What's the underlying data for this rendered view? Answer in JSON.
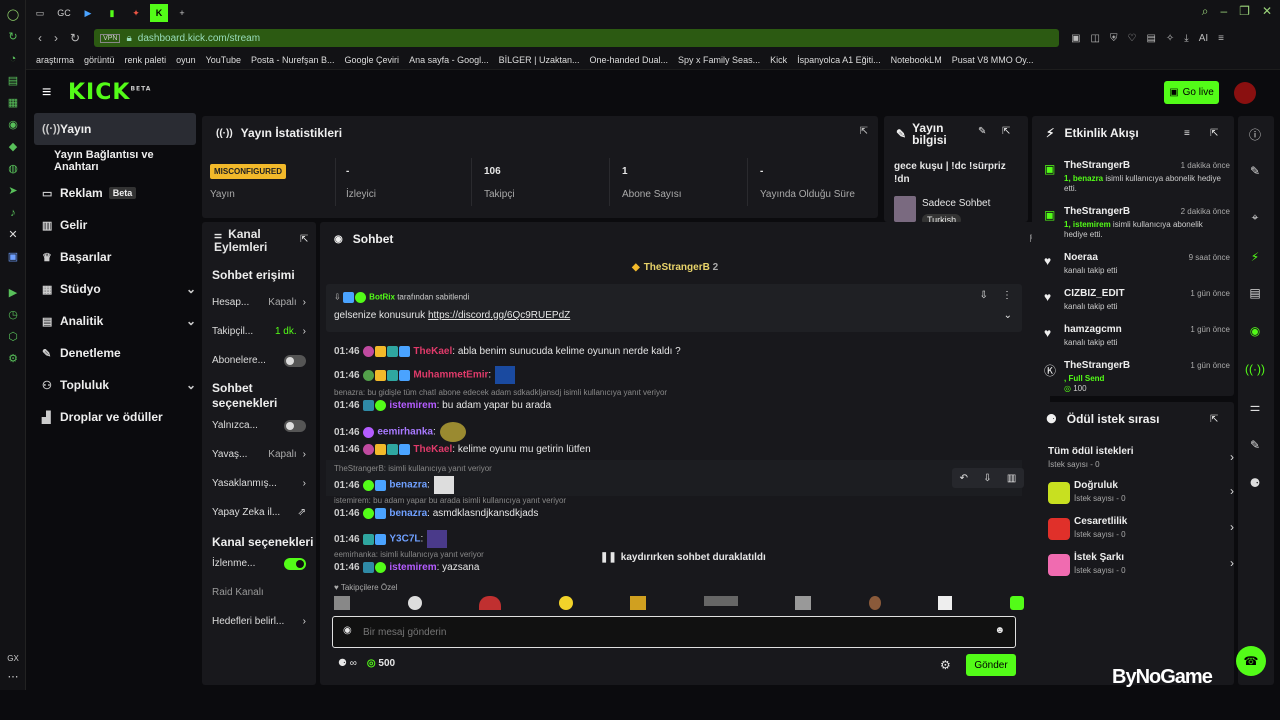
{
  "browser": {
    "url": "dashboard.kick.com/stream",
    "vpn_label": "VPN",
    "tabs": [
      "GC",
      "K"
    ],
    "bookmarks": [
      "araştırma",
      "görüntü",
      "renk paleti",
      "oyun",
      "YouTube",
      "Posta - Nurefşan B...",
      "Google Çeviri",
      "Ana sayfa - Googl...",
      "BİLGER | Uzaktan...",
      "One-handed Dual...",
      "Spy x Family Seas...",
      "Kick",
      "İspanyolca A1 Eğiti...",
      "NotebookLM",
      "Pusat V8 MMO Oy..."
    ],
    "ai_label": "AI"
  },
  "header": {
    "logo": "KICK",
    "logo_sup": "BETA",
    "go_live": "Go live"
  },
  "nav": {
    "items": [
      {
        "label": "Yayın"
      },
      {
        "label": "Yayın Bağlantısı ve Anahtarı"
      },
      {
        "label": "Reklam",
        "badge": "Beta"
      },
      {
        "label": "Gelir"
      },
      {
        "label": "Başarılar"
      },
      {
        "label": "Stüdyo"
      },
      {
        "label": "Analitik"
      },
      {
        "label": "Denetleme"
      },
      {
        "label": "Topluluk"
      },
      {
        "label": "Droplar ve ödüller"
      }
    ]
  },
  "stats": {
    "title": "Yayın İstatistikleri",
    "status_badge": "MISCONFIGURED",
    "status_label": "Yayın",
    "items": [
      {
        "value": "-",
        "label": "İzleyici"
      },
      {
        "value": "106",
        "label": "Takipçi"
      },
      {
        "value": "1",
        "label": "Abone Sayısı"
      },
      {
        "value": "-",
        "label": "Yayında Olduğu Süre"
      }
    ]
  },
  "info": {
    "title": "Yayın bilgisi",
    "stream_title": "gece kuşu | !dc !sürpriz !dn",
    "category": "Sadece Sohbet",
    "tag": "Turkish"
  },
  "actions": {
    "title": "Kanal Eylemleri",
    "sec1": "Sohbet erişimi",
    "r1": "Hesap...",
    "r1v": "Kapalı",
    "r2": "Takipçil...",
    "r2v": "1 dk.",
    "r3": "Abonelere...",
    "sec2": "Sohbet seçenekleri",
    "r4": "Yalnızca...",
    "r5": "Yavaş...",
    "r5v": "Kapalı",
    "r6": "Yasaklanmış...",
    "r7": "Yapay Zeka il...",
    "sec3": "Kanal seçenekleri",
    "r8": "İzlenme...",
    "r9": "Raid Kanalı",
    "r10": "Hedefleri belirl..."
  },
  "chat": {
    "title": "Sohbet",
    "top_user": "TheStrangerB",
    "top_count": "2",
    "pinned_by": "BotRix",
    "pinned_suffix": "tarafından sabitlendi",
    "pinned_text": "gelsenize konusuruk",
    "pinned_link": "https://discord.gg/6Qc9RUEPdZ",
    "messages": [
      {
        "time": "01:46",
        "user": "TheKael",
        "text": ": abla benim sunucuda kelime oyunun nerde kaldı ?"
      },
      {
        "time": "01:46",
        "user": "MuhammetEmir",
        "text": ":"
      },
      {
        "time": "01:46",
        "user": "istemirem",
        "text": ": bu adam yapar bu arada",
        "reply": "benazra: bu gidişle tüm chatI abone edecek adam sdkadkljansdj isimli kullanıcıya yanıt veriyor"
      },
      {
        "time": "01:46",
        "user": "eemirhanka",
        "text": ":"
      },
      {
        "time": "01:46",
        "user": "TheKael",
        "text": ": kelime oyunu mu getirin lütfen"
      },
      {
        "time": "01:46",
        "user": "benazra",
        "text": ":",
        "reply": "TheStrangerB:  isimli kullanıcıya yanıt veriyor"
      },
      {
        "time": "01:46",
        "user": "benazra",
        "text": ": asmdklasndjkansdkjads",
        "reply": "istemirem: bu adam yapar bu arada isimli kullanıcıya yanıt veriyor"
      },
      {
        "time": "01:46",
        "user": "Y3C7L",
        "text": ":"
      },
      {
        "time": "01:46",
        "user": "istemirem",
        "text": ": yazsana",
        "reply": "eemirhanka:  isimli kullanıcıya yanıt veriyor"
      }
    ],
    "paused": "kaydırırken sohbet duraklatıldı",
    "followers_only": "Takipçilere Özel",
    "input_placeholder": "Bir mesaj gönderin",
    "points": "500",
    "send": "Gönder"
  },
  "activity": {
    "title": "Etkinlik Akışı",
    "events": [
      {
        "name": "TheStrangerB",
        "time": "1 dakika önce",
        "hl": "1, benazra",
        "desc": " isimli kullanıcıya abonelik hediye etti."
      },
      {
        "name": "TheStrangerB",
        "time": "2 dakika önce",
        "hl": "1, istemirem",
        "desc": " isimli kullanıcıya abonelik hediye etti."
      },
      {
        "name": "Noeraa",
        "time": "9 saat önce",
        "hl": "",
        "desc": "kanalı takip etti"
      },
      {
        "name": "CIZBIZ_EDIT",
        "time": "1 gün önce",
        "hl": "",
        "desc": "kanalı takip etti"
      },
      {
        "name": "hamzagcmn",
        "time": "1 gün önce",
        "hl": "",
        "desc": "kanalı takip etti"
      },
      {
        "name": "TheStrangerB",
        "time": "1 gün önce",
        "hl": ", Full Send",
        "desc": ""
      }
    ],
    "last_amount": "100"
  },
  "rewards": {
    "title": "Ödül istek sırası",
    "items": [
      {
        "name": "Tüm ödül istekleri",
        "sub": "İstek sayısı - 0"
      },
      {
        "name": "Doğruluk",
        "sub": "İstek sayısı - 0"
      },
      {
        "name": "Cesaretlilik",
        "sub": "İstek sayısı - 0"
      },
      {
        "name": "İstek Şarkı",
        "sub": "İstek sayısı - 0"
      }
    ]
  },
  "watermark": "ByNoGame",
  "colors": {
    "accent": "#53fc18",
    "panel": "#18181c",
    "bg": "#0b0b0e"
  }
}
